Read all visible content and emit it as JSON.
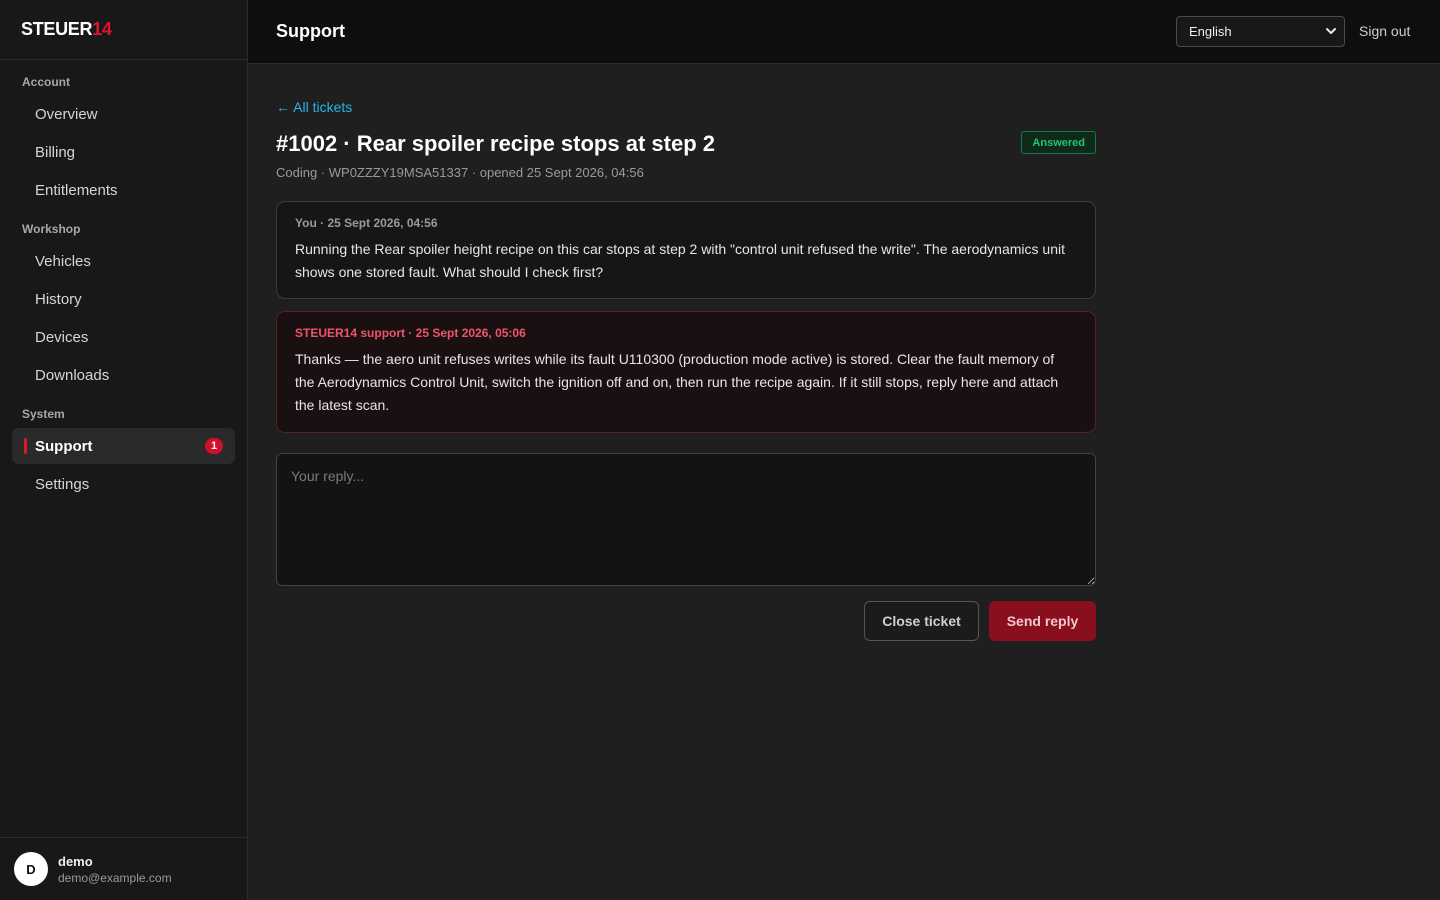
{
  "brand": {
    "name": "STEUER",
    "suffix": "14"
  },
  "sidebar": {
    "sections": [
      {
        "label": "Account",
        "items": [
          {
            "label": "Overview"
          },
          {
            "label": "Billing"
          },
          {
            "label": "Entitlements"
          }
        ]
      },
      {
        "label": "Workshop",
        "items": [
          {
            "label": "Vehicles"
          },
          {
            "label": "History"
          },
          {
            "label": "Devices"
          },
          {
            "label": "Downloads"
          }
        ]
      },
      {
        "label": "System",
        "items": [
          {
            "label": "Support",
            "badge": "1",
            "active": true
          },
          {
            "label": "Settings"
          }
        ]
      }
    ]
  },
  "user": {
    "initial": "D",
    "name": "demo",
    "email": "demo@example.com"
  },
  "header": {
    "title": "Support",
    "language": "English",
    "sign_out": "Sign out"
  },
  "ticket": {
    "back_link": "← All tickets",
    "title": "#1002 · Rear spoiler recipe stops at step 2",
    "status": "Answered",
    "meta": "Coding · WP0ZZZY19MSA51337 · opened 25 Sept 2026, 04:56",
    "messages": [
      {
        "author_line": "You · 25 Sept 2026, 04:56",
        "body": "Running the Rear spoiler height recipe on this car stops at step 2 with \"control unit refused the write\". The aerodynamics unit shows one stored fault. What should I check first?"
      },
      {
        "author_line": "STEUER14 support · 25 Sept 2026, 05:06",
        "body": "Thanks — the aero unit refuses writes while its fault U110300 (production mode active) is stored. Clear the fault memory of the Aerodynamics Control Unit, switch the ignition off and on, then run the recipe again. If it still stops, reply here and attach the latest scan."
      }
    ],
    "reply_placeholder": "Your reply...",
    "reply_value": "",
    "close_label": "Close ticket",
    "send_label": "Send reply"
  },
  "colors": {
    "accent": "#e0142c",
    "link": "#28b4e6",
    "status_green": "#25c46e"
  }
}
